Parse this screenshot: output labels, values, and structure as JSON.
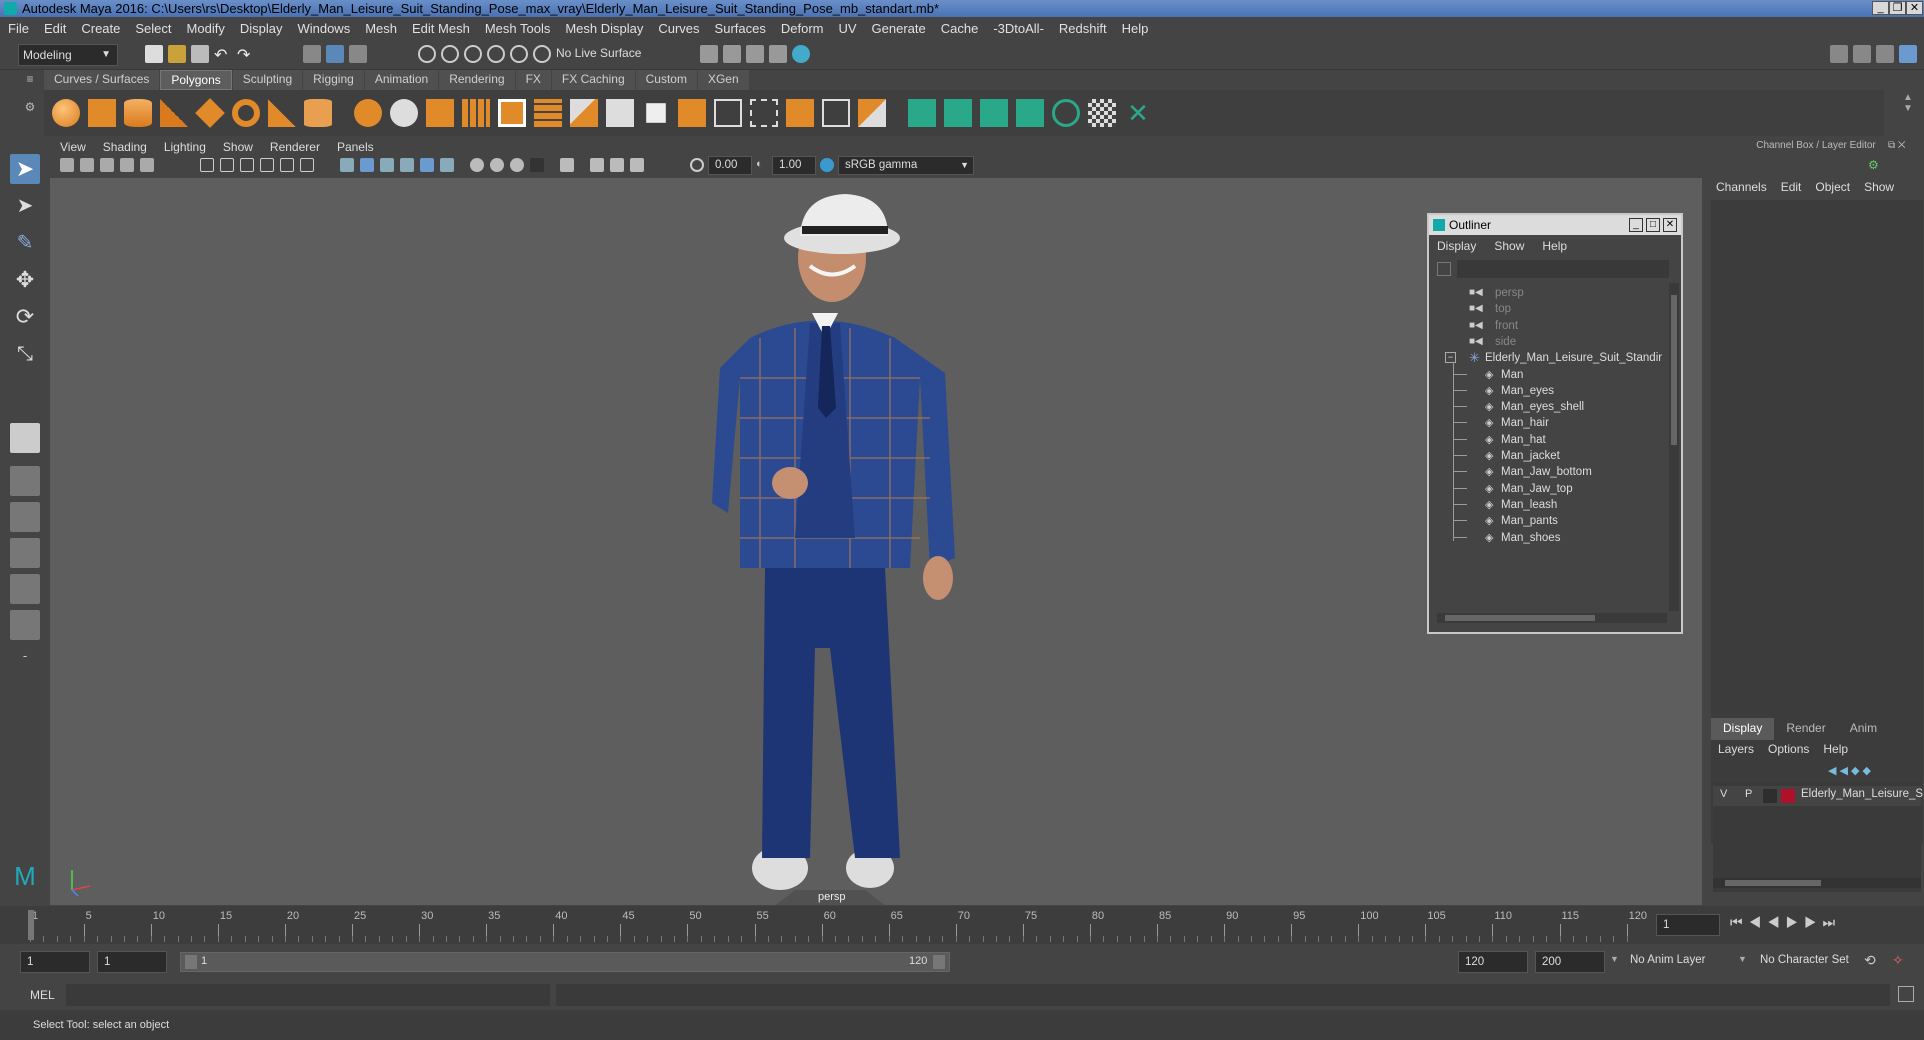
{
  "window": {
    "title": "Autodesk Maya 2016: C:\\Users\\rs\\Desktop\\Elderly_Man_Leisure_Suit_Standing_Pose_max_vray\\Elderly_Man_Leisure_Suit_Standing_Pose_mb_standart.mb*"
  },
  "menubar": [
    "File",
    "Edit",
    "Create",
    "Select",
    "Modify",
    "Display",
    "Windows",
    "Mesh",
    "Edit Mesh",
    "Mesh Tools",
    "Mesh Display",
    "Curves",
    "Surfaces",
    "Deform",
    "UV",
    "Generate",
    "Cache",
    "-3DtoAll-",
    "Redshift",
    "Help"
  ],
  "status": {
    "mode": "Modeling",
    "live_surface": "No Live Surface"
  },
  "shelf_tabs": [
    "Curves / Surfaces",
    "Polygons",
    "Sculpting",
    "Rigging",
    "Animation",
    "Rendering",
    "FX",
    "FX Caching",
    "Custom",
    "XGen"
  ],
  "shelf_active": "Polygons",
  "panel_menu": [
    "View",
    "Shading",
    "Lighting",
    "Show",
    "Renderer",
    "Panels"
  ],
  "panel_toolbar": {
    "exposure": "0.00",
    "gamma": "1.00",
    "colorspace": "sRGB gamma"
  },
  "viewport": {
    "camera_label": "persp"
  },
  "outliner": {
    "title": "Outliner",
    "menu": [
      "Display",
      "Show",
      "Help"
    ],
    "cameras": [
      "persp",
      "top",
      "front",
      "side"
    ],
    "group": "Elderly_Man_Leisure_Suit_Standir",
    "children": [
      "Man",
      "Man_eyes",
      "Man_eyes_shell",
      "Man_hair",
      "Man_hat",
      "Man_jacket",
      "Man_Jaw_bottom",
      "Man_Jaw_top",
      "Man_leash",
      "Man_pants",
      "Man_shoes"
    ]
  },
  "channelbox": {
    "title": "Channel Box / Layer Editor",
    "menu": [
      "Channels",
      "Edit",
      "Object",
      "Show"
    ],
    "layer_tabs": [
      "Display",
      "Render",
      "Anim"
    ],
    "layer_active": "Display",
    "layer_menu": [
      "Layers",
      "Options",
      "Help"
    ],
    "layer": {
      "v": "V",
      "p": "P",
      "name": "Elderly_Man_Leisure_S",
      "color": "#b0102a"
    }
  },
  "timeline": {
    "ticks": [
      "1",
      "5",
      "10",
      "15",
      "20",
      "25",
      "30",
      "35",
      "40",
      "45",
      "50",
      "55",
      "60",
      "65",
      "70",
      "75",
      "80",
      "85",
      "90",
      "95",
      "100",
      "105",
      "110",
      "115",
      "120"
    ],
    "current": "1"
  },
  "range": {
    "start": "1",
    "playback_start": "1",
    "slider_start": "1",
    "slider_end": "120",
    "playback_end": "120",
    "end": "200",
    "anim_layer": "No Anim Layer",
    "char_set": "No Character Set"
  },
  "cmdline": {
    "label": "MEL"
  },
  "helpline": {
    "text": "Select Tool: select an object"
  }
}
